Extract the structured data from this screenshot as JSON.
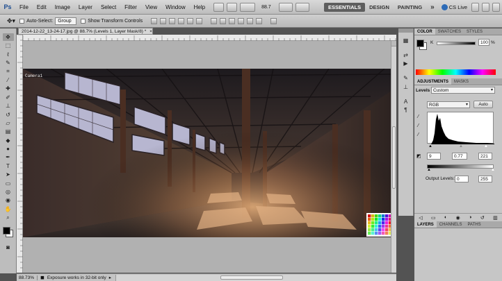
{
  "app": {
    "logo": "Ps",
    "menu": [
      "File",
      "Edit",
      "Image",
      "Layer",
      "Select",
      "Filter",
      "View",
      "Window",
      "Help"
    ],
    "zoom_value": "88.7",
    "workspaces": [
      "ESSENTIALS",
      "DESIGN",
      "PAINTING"
    ],
    "workspace_more": "»",
    "cs_live": "CS Live"
  },
  "options_bar": {
    "auto_select_label": "Auto-Select:",
    "auto_select_value": "Group",
    "transform_controls_label": "Show Transform Controls"
  },
  "document": {
    "tab_title": "2014-12-22_13-24-17.jpg @ 88.7% (Levels 1, Layer Mask/8) *",
    "close": "×",
    "camera_label": "Camera1"
  },
  "status": {
    "zoom": "88.73%",
    "message": "Exposure works in 32-bit only"
  },
  "color_panel": {
    "tabs": [
      "COLOR",
      "SWATCHES",
      "STYLES"
    ],
    "channel": "K",
    "value": "100",
    "unit": "%"
  },
  "adjustments_panel": {
    "tabs": [
      "ADJUSTMENTS",
      "MASKS"
    ],
    "title": "Levels",
    "preset": "Custom",
    "channel": "RGB",
    "auto_label": "Auto",
    "input_black": "9",
    "input_gamma": "0.77",
    "input_white": "221",
    "output_label": "Output Levels:",
    "output_black": "0",
    "output_white": "255"
  },
  "layers_panel": {
    "tabs": [
      "LAYERS",
      "CHANNELS",
      "PATHS"
    ]
  },
  "colors": {
    "ui_bg": "#535353",
    "panel_bg": "#c6c6c6",
    "active_workspace": "#5e5e5e",
    "canvas_bg": "#b1b1b1"
  }
}
